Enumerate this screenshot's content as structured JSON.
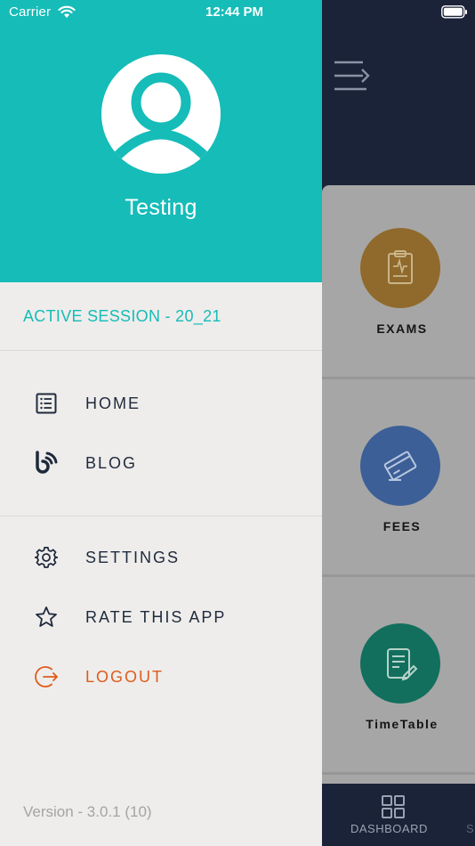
{
  "status_bar": {
    "carrier": "Carrier",
    "time": "12:44 PM"
  },
  "drawer": {
    "user_name": "Testing",
    "active_session": "ACTIVE SESSION - 20_21",
    "primary_items": [
      {
        "label": "HOME",
        "icon": "list-icon"
      },
      {
        "label": "BLOG",
        "icon": "blog-icon"
      }
    ],
    "secondary_items": [
      {
        "label": "SETTINGS",
        "icon": "gear-icon"
      },
      {
        "label": "RATE THIS APP",
        "icon": "star-icon"
      },
      {
        "label": "LOGOUT",
        "icon": "logout-icon"
      }
    ],
    "version": "Version - 3.0.1 (10)"
  },
  "dashboard": {
    "cards": [
      {
        "label": "EXAMS",
        "icon": "exam-clipboard-icon",
        "color": "#8f6a2c"
      },
      {
        "label": "FEES",
        "icon": "credit-card-icon",
        "color": "#3c5f97"
      },
      {
        "label": "TimeTable",
        "icon": "timetable-note-icon",
        "color": "#126f5d"
      }
    ],
    "tabs": [
      {
        "label": "DASHBOARD",
        "icon": "grid-icon"
      },
      {
        "label": "S"
      }
    ]
  },
  "colors": {
    "accent": "#16bcb8",
    "navy": "#1a2338",
    "logout": "#e05a1a",
    "drawer_bg": "#eeedeb"
  }
}
